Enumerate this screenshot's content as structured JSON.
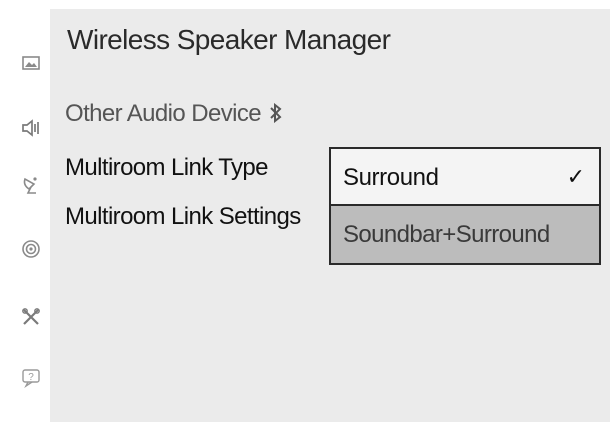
{
  "header": {
    "title": "Wireless Speaker Manager"
  },
  "sidebar": {
    "icons": [
      "picture-icon",
      "speaker-icon",
      "broadcast-icon",
      "network-icon",
      "tools-icon",
      "support-icon"
    ]
  },
  "menu": {
    "items": [
      {
        "label": "Other Audio Device",
        "icon": "bluetooth-icon"
      },
      {
        "label": "Multiroom Link Type"
      },
      {
        "label": "Multiroom Link Settings"
      }
    ]
  },
  "dropdown": {
    "options": [
      {
        "label": "Surround",
        "selected": true,
        "check": "✓"
      },
      {
        "label": "Soundbar+Surround",
        "selected": false
      }
    ]
  }
}
